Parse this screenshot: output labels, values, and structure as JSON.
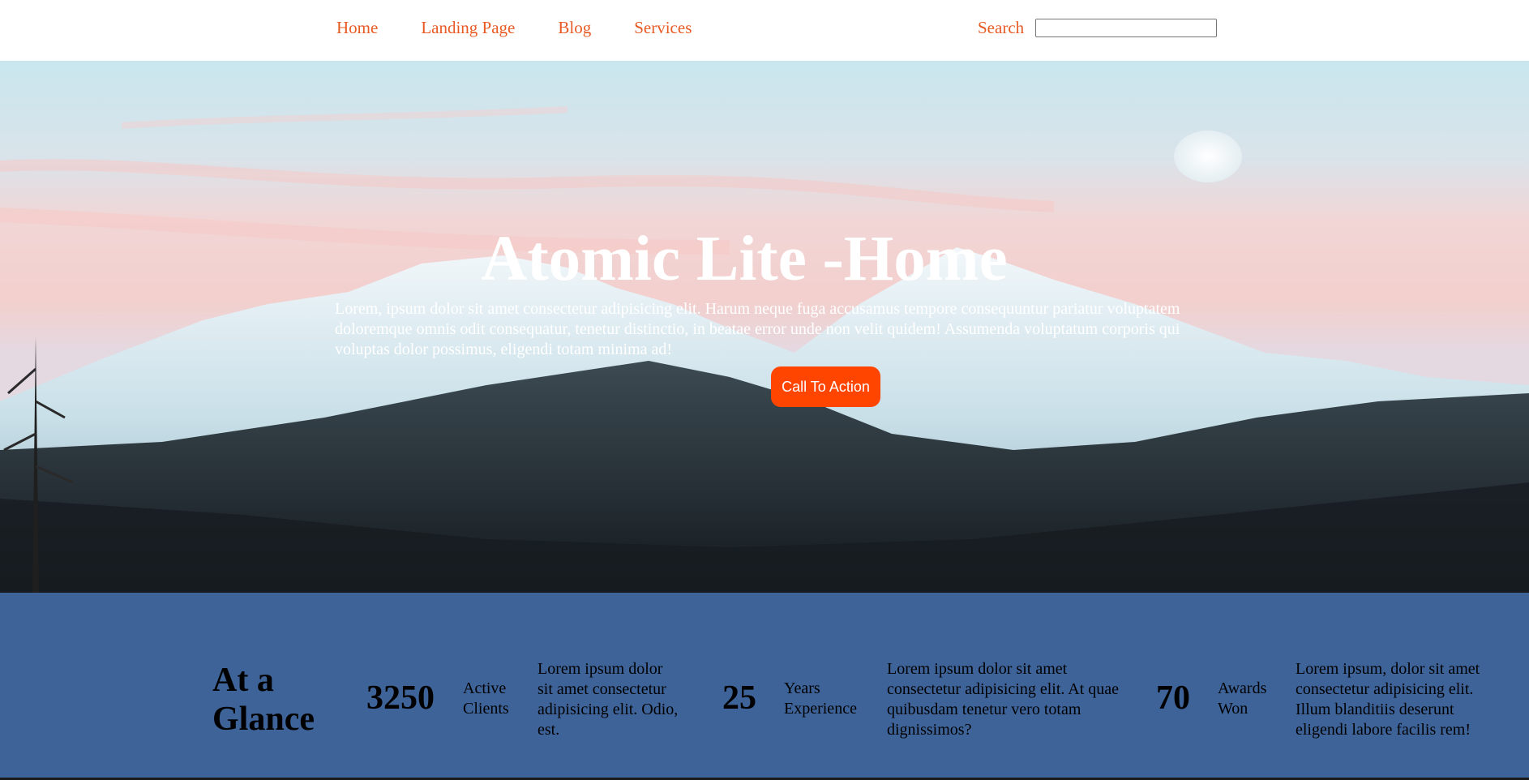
{
  "nav": {
    "links": [
      "Home",
      "Landing Page",
      "Blog",
      "Services"
    ],
    "search_label": "Search",
    "search_value": "",
    "link_color": "#e85a24"
  },
  "hero": {
    "title": "Atomic Lite -Home",
    "text": "Lorem, ipsum dolor sit amet consectetur adipisicing elit. Harum neque fuga accusamus tempore consequuntur pariatur voluptatem doloremque omnis odit consequatur, tenetur distinctio, in beatae error unde non velit quidem! Assumenda voluptatum corporis qui voluptas dolor possimus, eligendi totam minima ad!",
    "cta_label": "Call To Action",
    "cta_color": "#ff4500",
    "background": "snowy-mountains-photo"
  },
  "stats": {
    "heading": "At a Glance",
    "background_color": "#3e6399",
    "items": [
      {
        "number": "3250",
        "label": "Active Clients",
        "description": "Lorem ipsum dolor sit amet consectetur adipisicing elit. Odio, est."
      },
      {
        "number": "25",
        "label": "Years Experience",
        "description": "Lorem ipsum dolor sit amet consectetur adipisicing elit. At quae quibusdam tenetur vero totam dignissimos?"
      },
      {
        "number": "70",
        "label": "Awards Won",
        "description": "Lorem ipsum, dolor sit amet consectetur adipisicing elit. Illum blanditiis deserunt eligendi labore facilis rem!"
      }
    ]
  }
}
